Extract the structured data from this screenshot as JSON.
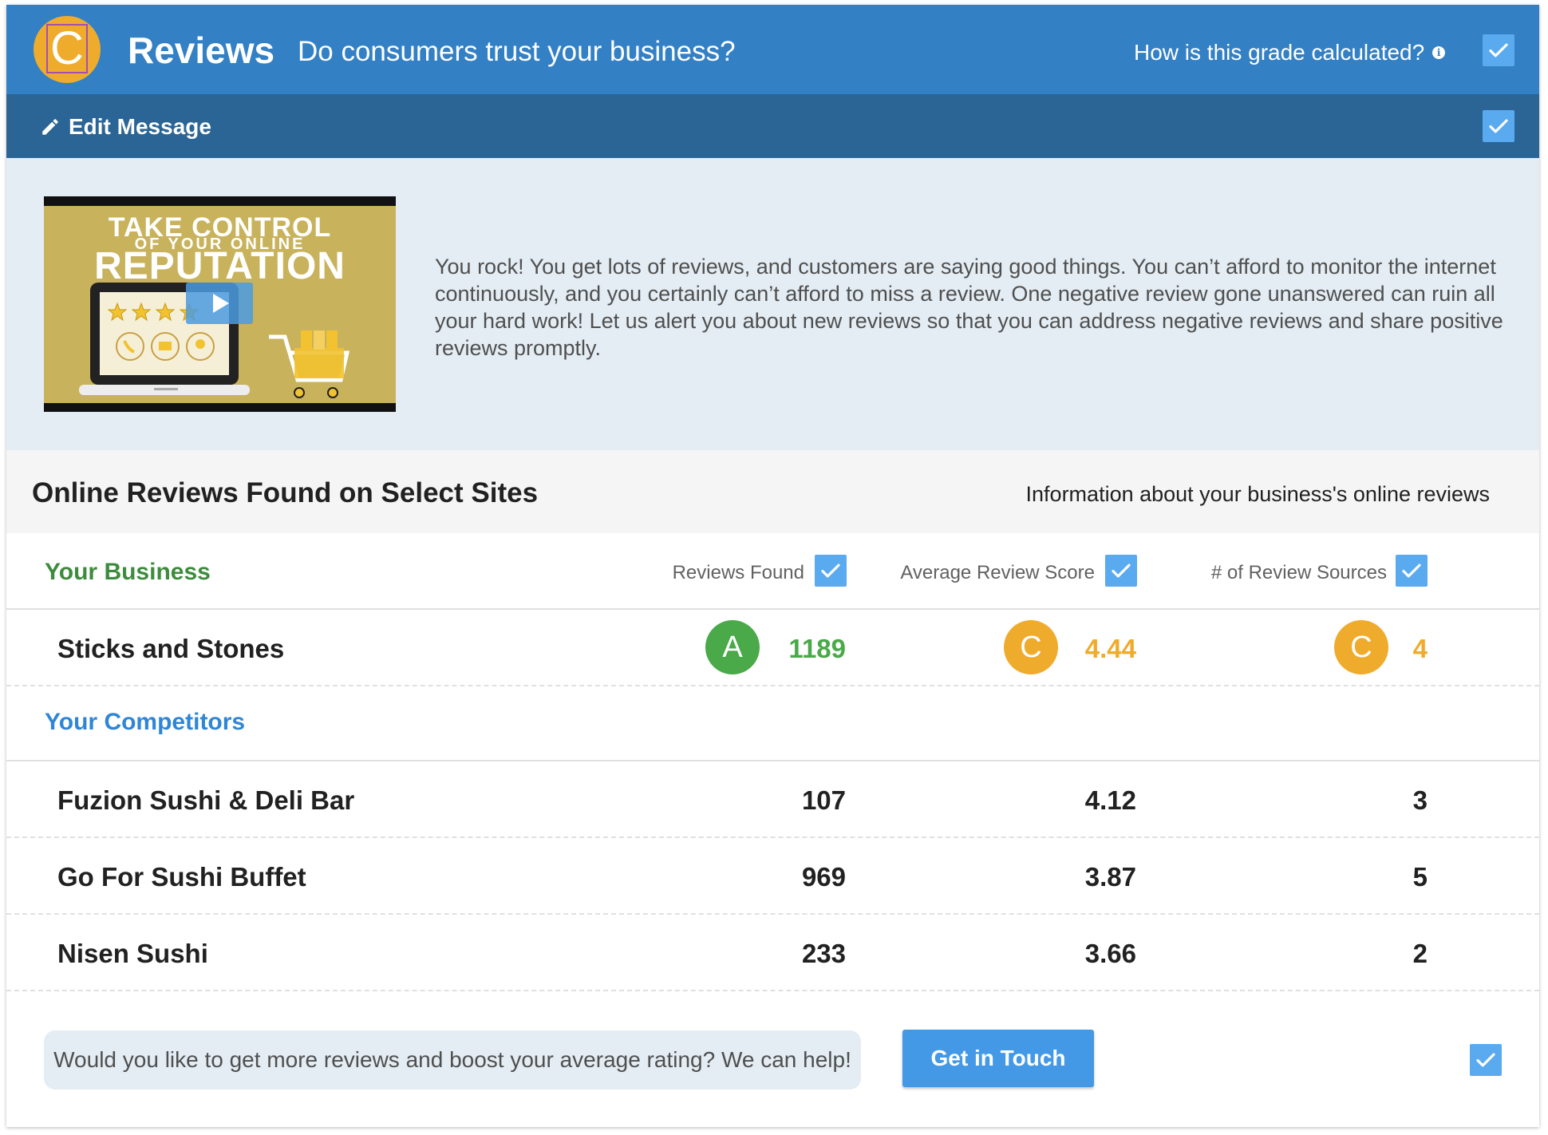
{
  "header": {
    "grade": "C",
    "grade_color": "#efab2c",
    "title": "Reviews",
    "subtitle": "Do consumers trust your business?",
    "how_link": "How is this grade calculated?",
    "info_icon": "info-icon",
    "bg_color": "#3380c4"
  },
  "editbar": {
    "label": "Edit Message",
    "icon": "pencil-icon",
    "bg_color": "#2a6595"
  },
  "message": {
    "video": {
      "line1": "TAKE CONTROL",
      "line2": "OF YOUR ONLINE",
      "line3": "REPUTATION"
    },
    "text": "You rock! You get lots of reviews, and customers are saying good things. You can’t afford to monitor the internet continuously, and you certainly can’t afford to miss a review. One negative review gone unanswered can ruin all your hard work! Let us alert you about new reviews so that you can address negative reviews and share positive reviews promptly."
  },
  "section": {
    "title": "Online Reviews Found on Select Sites",
    "info": "Information about your business's online reviews"
  },
  "table": {
    "your_business_label": "Your Business",
    "competitors_label": "Your Competitors",
    "columns": [
      "Reviews Found",
      "Average Review Score",
      "# of Review Sources"
    ],
    "business": {
      "name": "Sticks and Stones",
      "reviews_grade": "A",
      "reviews": "1189",
      "score_grade": "C",
      "score": "4.44",
      "sources_grade": "C",
      "sources": "4"
    },
    "competitors": [
      {
        "name": "Fuzion Sushi & Deli Bar",
        "reviews": "107",
        "score": "4.12",
        "sources": "3"
      },
      {
        "name": "Go For Sushi Buffet",
        "reviews": "969",
        "score": "3.87",
        "sources": "5"
      },
      {
        "name": "Nisen Sushi",
        "reviews": "233",
        "score": "3.66",
        "sources": "2"
      }
    ],
    "colors": {
      "grade_a": "#4aa949",
      "grade_c": "#efab2c",
      "business_label": "#3d8c3d",
      "competitor_label": "#2f86d6"
    }
  },
  "cta": {
    "message": "Would you like to get more reviews and boost your average rating? We can help!",
    "button": "Get in Touch"
  }
}
